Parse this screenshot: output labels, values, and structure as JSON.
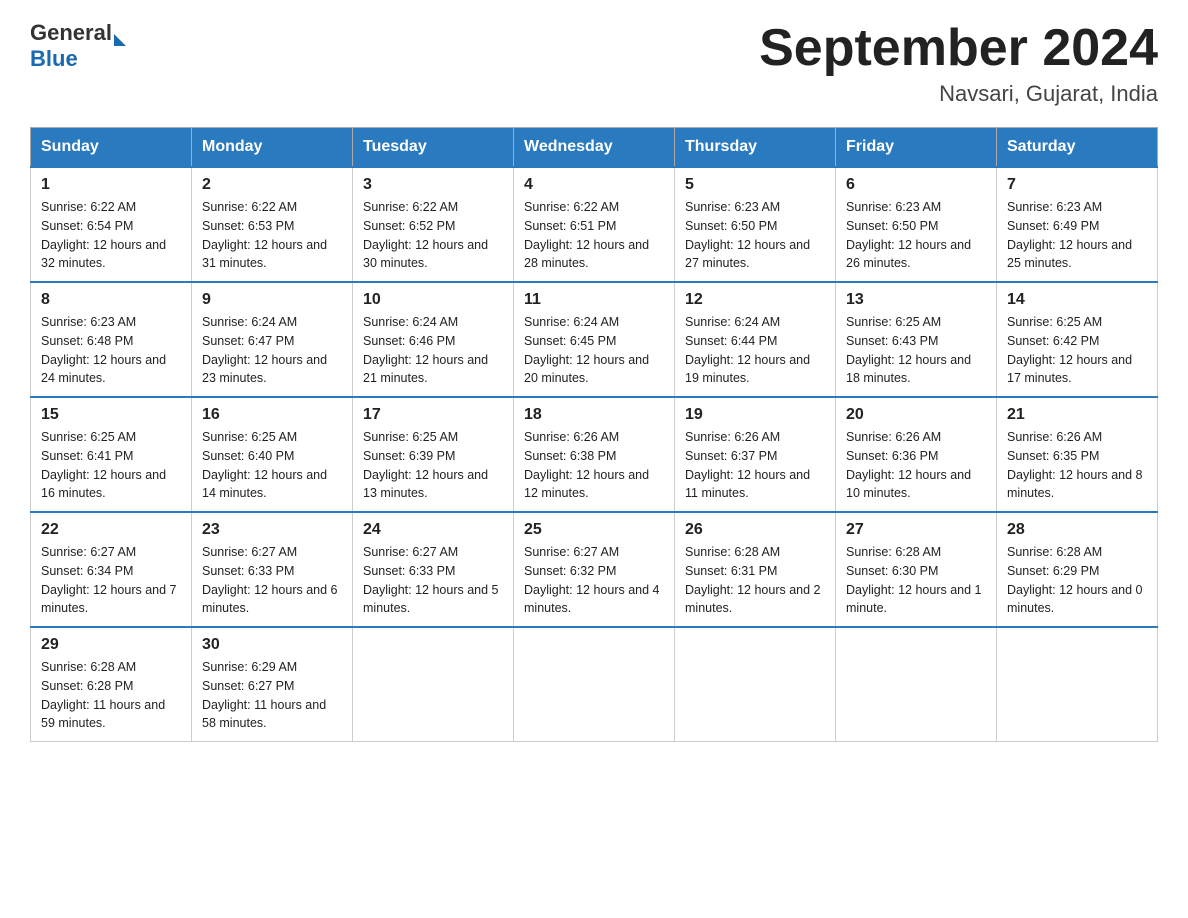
{
  "header": {
    "logo_text": "General",
    "logo_blue": "Blue",
    "month_title": "September 2024",
    "location": "Navsari, Gujarat, India"
  },
  "weekdays": [
    "Sunday",
    "Monday",
    "Tuesday",
    "Wednesday",
    "Thursday",
    "Friday",
    "Saturday"
  ],
  "weeks": [
    [
      {
        "day": "1",
        "sunrise": "Sunrise: 6:22 AM",
        "sunset": "Sunset: 6:54 PM",
        "daylight": "Daylight: 12 hours and 32 minutes."
      },
      {
        "day": "2",
        "sunrise": "Sunrise: 6:22 AM",
        "sunset": "Sunset: 6:53 PM",
        "daylight": "Daylight: 12 hours and 31 minutes."
      },
      {
        "day": "3",
        "sunrise": "Sunrise: 6:22 AM",
        "sunset": "Sunset: 6:52 PM",
        "daylight": "Daylight: 12 hours and 30 minutes."
      },
      {
        "day": "4",
        "sunrise": "Sunrise: 6:22 AM",
        "sunset": "Sunset: 6:51 PM",
        "daylight": "Daylight: 12 hours and 28 minutes."
      },
      {
        "day": "5",
        "sunrise": "Sunrise: 6:23 AM",
        "sunset": "Sunset: 6:50 PM",
        "daylight": "Daylight: 12 hours and 27 minutes."
      },
      {
        "day": "6",
        "sunrise": "Sunrise: 6:23 AM",
        "sunset": "Sunset: 6:50 PM",
        "daylight": "Daylight: 12 hours and 26 minutes."
      },
      {
        "day": "7",
        "sunrise": "Sunrise: 6:23 AM",
        "sunset": "Sunset: 6:49 PM",
        "daylight": "Daylight: 12 hours and 25 minutes."
      }
    ],
    [
      {
        "day": "8",
        "sunrise": "Sunrise: 6:23 AM",
        "sunset": "Sunset: 6:48 PM",
        "daylight": "Daylight: 12 hours and 24 minutes."
      },
      {
        "day": "9",
        "sunrise": "Sunrise: 6:24 AM",
        "sunset": "Sunset: 6:47 PM",
        "daylight": "Daylight: 12 hours and 23 minutes."
      },
      {
        "day": "10",
        "sunrise": "Sunrise: 6:24 AM",
        "sunset": "Sunset: 6:46 PM",
        "daylight": "Daylight: 12 hours and 21 minutes."
      },
      {
        "day": "11",
        "sunrise": "Sunrise: 6:24 AM",
        "sunset": "Sunset: 6:45 PM",
        "daylight": "Daylight: 12 hours and 20 minutes."
      },
      {
        "day": "12",
        "sunrise": "Sunrise: 6:24 AM",
        "sunset": "Sunset: 6:44 PM",
        "daylight": "Daylight: 12 hours and 19 minutes."
      },
      {
        "day": "13",
        "sunrise": "Sunrise: 6:25 AM",
        "sunset": "Sunset: 6:43 PM",
        "daylight": "Daylight: 12 hours and 18 minutes."
      },
      {
        "day": "14",
        "sunrise": "Sunrise: 6:25 AM",
        "sunset": "Sunset: 6:42 PM",
        "daylight": "Daylight: 12 hours and 17 minutes."
      }
    ],
    [
      {
        "day": "15",
        "sunrise": "Sunrise: 6:25 AM",
        "sunset": "Sunset: 6:41 PM",
        "daylight": "Daylight: 12 hours and 16 minutes."
      },
      {
        "day": "16",
        "sunrise": "Sunrise: 6:25 AM",
        "sunset": "Sunset: 6:40 PM",
        "daylight": "Daylight: 12 hours and 14 minutes."
      },
      {
        "day": "17",
        "sunrise": "Sunrise: 6:25 AM",
        "sunset": "Sunset: 6:39 PM",
        "daylight": "Daylight: 12 hours and 13 minutes."
      },
      {
        "day": "18",
        "sunrise": "Sunrise: 6:26 AM",
        "sunset": "Sunset: 6:38 PM",
        "daylight": "Daylight: 12 hours and 12 minutes."
      },
      {
        "day": "19",
        "sunrise": "Sunrise: 6:26 AM",
        "sunset": "Sunset: 6:37 PM",
        "daylight": "Daylight: 12 hours and 11 minutes."
      },
      {
        "day": "20",
        "sunrise": "Sunrise: 6:26 AM",
        "sunset": "Sunset: 6:36 PM",
        "daylight": "Daylight: 12 hours and 10 minutes."
      },
      {
        "day": "21",
        "sunrise": "Sunrise: 6:26 AM",
        "sunset": "Sunset: 6:35 PM",
        "daylight": "Daylight: 12 hours and 8 minutes."
      }
    ],
    [
      {
        "day": "22",
        "sunrise": "Sunrise: 6:27 AM",
        "sunset": "Sunset: 6:34 PM",
        "daylight": "Daylight: 12 hours and 7 minutes."
      },
      {
        "day": "23",
        "sunrise": "Sunrise: 6:27 AM",
        "sunset": "Sunset: 6:33 PM",
        "daylight": "Daylight: 12 hours and 6 minutes."
      },
      {
        "day": "24",
        "sunrise": "Sunrise: 6:27 AM",
        "sunset": "Sunset: 6:33 PM",
        "daylight": "Daylight: 12 hours and 5 minutes."
      },
      {
        "day": "25",
        "sunrise": "Sunrise: 6:27 AM",
        "sunset": "Sunset: 6:32 PM",
        "daylight": "Daylight: 12 hours and 4 minutes."
      },
      {
        "day": "26",
        "sunrise": "Sunrise: 6:28 AM",
        "sunset": "Sunset: 6:31 PM",
        "daylight": "Daylight: 12 hours and 2 minutes."
      },
      {
        "day": "27",
        "sunrise": "Sunrise: 6:28 AM",
        "sunset": "Sunset: 6:30 PM",
        "daylight": "Daylight: 12 hours and 1 minute."
      },
      {
        "day": "28",
        "sunrise": "Sunrise: 6:28 AM",
        "sunset": "Sunset: 6:29 PM",
        "daylight": "Daylight: 12 hours and 0 minutes."
      }
    ],
    [
      {
        "day": "29",
        "sunrise": "Sunrise: 6:28 AM",
        "sunset": "Sunset: 6:28 PM",
        "daylight": "Daylight: 11 hours and 59 minutes."
      },
      {
        "day": "30",
        "sunrise": "Sunrise: 6:29 AM",
        "sunset": "Sunset: 6:27 PM",
        "daylight": "Daylight: 11 hours and 58 minutes."
      },
      null,
      null,
      null,
      null,
      null
    ]
  ]
}
